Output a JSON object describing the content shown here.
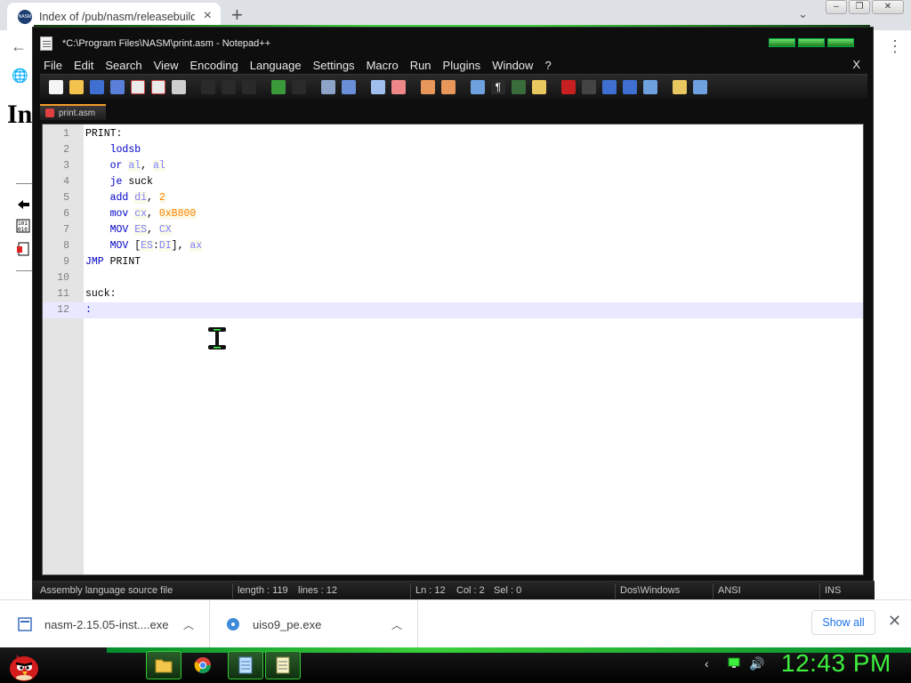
{
  "browser": {
    "tab_title": "Index of /pub/nasm/releasebuilds",
    "tab_favicon_text": "NASM",
    "new_tab_label": "+",
    "page_heading": "In"
  },
  "notepad": {
    "window_title": "*C:\\Program Files\\NASM\\print.asm - Notepad++",
    "menu": [
      "File",
      "Edit",
      "Search",
      "View",
      "Encoding",
      "Language",
      "Settings",
      "Macro",
      "Run",
      "Plugins",
      "Window",
      "?"
    ],
    "menu_close": "X",
    "document_tab": "print.asm",
    "lines": [
      {
        "num": "1",
        "tokens": [
          {
            "t": "PRINT:",
            "c": "plain"
          }
        ]
      },
      {
        "num": "2",
        "tokens": [
          {
            "t": "    ",
            "c": "plain"
          },
          {
            "t": "lodsb",
            "c": "kw"
          }
        ]
      },
      {
        "num": "3",
        "tokens": [
          {
            "t": "    ",
            "c": "plain"
          },
          {
            "t": "or",
            "c": "kw"
          },
          {
            "t": " ",
            "c": "plain"
          },
          {
            "t": "al",
            "c": "reg"
          },
          {
            "t": ", ",
            "c": "plain"
          },
          {
            "t": "al",
            "c": "reg"
          }
        ]
      },
      {
        "num": "4",
        "tokens": [
          {
            "t": "    ",
            "c": "plain"
          },
          {
            "t": "je",
            "c": "kw"
          },
          {
            "t": " suck",
            "c": "plain"
          }
        ]
      },
      {
        "num": "5",
        "tokens": [
          {
            "t": "    ",
            "c": "plain"
          },
          {
            "t": "add",
            "c": "kw"
          },
          {
            "t": " ",
            "c": "plain"
          },
          {
            "t": "di",
            "c": "reg"
          },
          {
            "t": ", ",
            "c": "plain"
          },
          {
            "t": "2",
            "c": "num"
          }
        ]
      },
      {
        "num": "6",
        "tokens": [
          {
            "t": "    ",
            "c": "plain"
          },
          {
            "t": "mov",
            "c": "kw"
          },
          {
            "t": " ",
            "c": "plain"
          },
          {
            "t": "cx",
            "c": "reg"
          },
          {
            "t": ", ",
            "c": "plain"
          },
          {
            "t": "0xB800",
            "c": "num"
          }
        ]
      },
      {
        "num": "7",
        "tokens": [
          {
            "t": "    ",
            "c": "plain"
          },
          {
            "t": "MOV",
            "c": "kw"
          },
          {
            "t": " ",
            "c": "plain"
          },
          {
            "t": "ES",
            "c": "reg"
          },
          {
            "t": ", ",
            "c": "plain"
          },
          {
            "t": "CX",
            "c": "reg"
          }
        ]
      },
      {
        "num": "8",
        "tokens": [
          {
            "t": "    ",
            "c": "plain"
          },
          {
            "t": "MOV",
            "c": "kw"
          },
          {
            "t": " [",
            "c": "plain"
          },
          {
            "t": "ES",
            "c": "reg"
          },
          {
            "t": ":",
            "c": "plain"
          },
          {
            "t": "DI",
            "c": "reg"
          },
          {
            "t": "], ",
            "c": "plain"
          },
          {
            "t": "ax",
            "c": "reg"
          }
        ]
      },
      {
        "num": "9",
        "tokens": [
          {
            "t": "JMP",
            "c": "kw"
          },
          {
            "t": " PRINT",
            "c": "plain"
          }
        ]
      },
      {
        "num": "10",
        "tokens": []
      },
      {
        "num": "11",
        "tokens": [
          {
            "t": "suck:",
            "c": "plain"
          }
        ]
      },
      {
        "num": "12",
        "tokens": [
          {
            "t": ":",
            "c": "kw"
          }
        ],
        "current": true
      }
    ],
    "status": {
      "file_type": "Assembly language source file",
      "length": "length : 119",
      "lines": "lines : 12",
      "ln": "Ln : 12",
      "col": "Col : 2",
      "sel": "Sel : 0",
      "eol": "Dos\\Windows",
      "encoding": "ANSI",
      "mode": "INS"
    }
  },
  "downloads": {
    "items": [
      {
        "name": "nasm-2.15.05-inst....exe"
      },
      {
        "name": "uiso9_pe.exe"
      }
    ],
    "show_all": "Show all"
  },
  "taskbar": {
    "clock": "12:43 PM"
  },
  "colors": {
    "accent_green": "#3ef13e",
    "keyword_blue": "#0000c8",
    "register_blue": "#8080ff",
    "number_orange": "#ff8000"
  }
}
